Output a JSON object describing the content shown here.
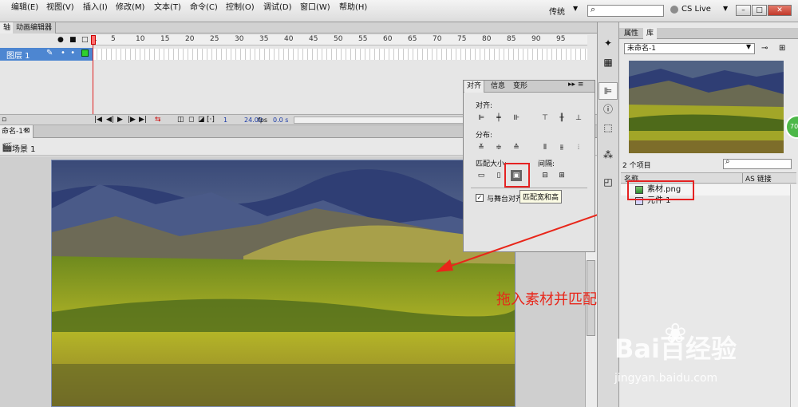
{
  "menus": [
    "编辑(E)",
    "视图(V)",
    "插入(I)",
    "修改(M)",
    "文本(T)",
    "命令(C)",
    "控制(O)",
    "调试(D)",
    "窗口(W)",
    "帮助(H)"
  ],
  "workspace": "传统",
  "cs_live": "CS Live",
  "window_buttons": [
    "–",
    "□",
    "✕"
  ],
  "timeline_tabs": [
    "轴",
    "动画编辑器"
  ],
  "frame_ruler": [
    "1",
    "5",
    "10",
    "15",
    "20",
    "25",
    "30",
    "35",
    "40",
    "45",
    "50",
    "55",
    "60",
    "65",
    "70",
    "75",
    "80",
    "85",
    "90",
    "95"
  ],
  "layer_name": "图层 1",
  "timeline_status": {
    "current_frame": "1",
    "fps_value": "24.00",
    "fps_unit": "fps",
    "time": "0.0 s"
  },
  "document_tab": "命名-1*",
  "scene_label": "场景 1",
  "align_panel": {
    "tabs": [
      "对齐",
      "信息",
      "变形"
    ],
    "sections": {
      "align": "对齐:",
      "distribute": "分布:",
      "match_size": "匹配大小:",
      "spacing": "间隔:"
    },
    "to_stage_label": "与舞台对齐",
    "to_stage_checked": true,
    "tooltip": "匹配宽和高"
  },
  "library": {
    "tabs": [
      "属性",
      "库"
    ],
    "document": "未命名-1",
    "item_count": "2 个项目",
    "columns": [
      "名称",
      "AS 链接"
    ],
    "items": [
      "素材.png",
      "元件 1"
    ]
  },
  "annotation": "拖入素材并匹配舞台大小",
  "badge": "70",
  "watermark": {
    "brand": "Bai百经验",
    "url": "jingyan.baidu.com"
  },
  "colors": {
    "annotation_red": "#e8261a",
    "layer_selected": "#4d86d1",
    "playhead": "#e02020"
  }
}
